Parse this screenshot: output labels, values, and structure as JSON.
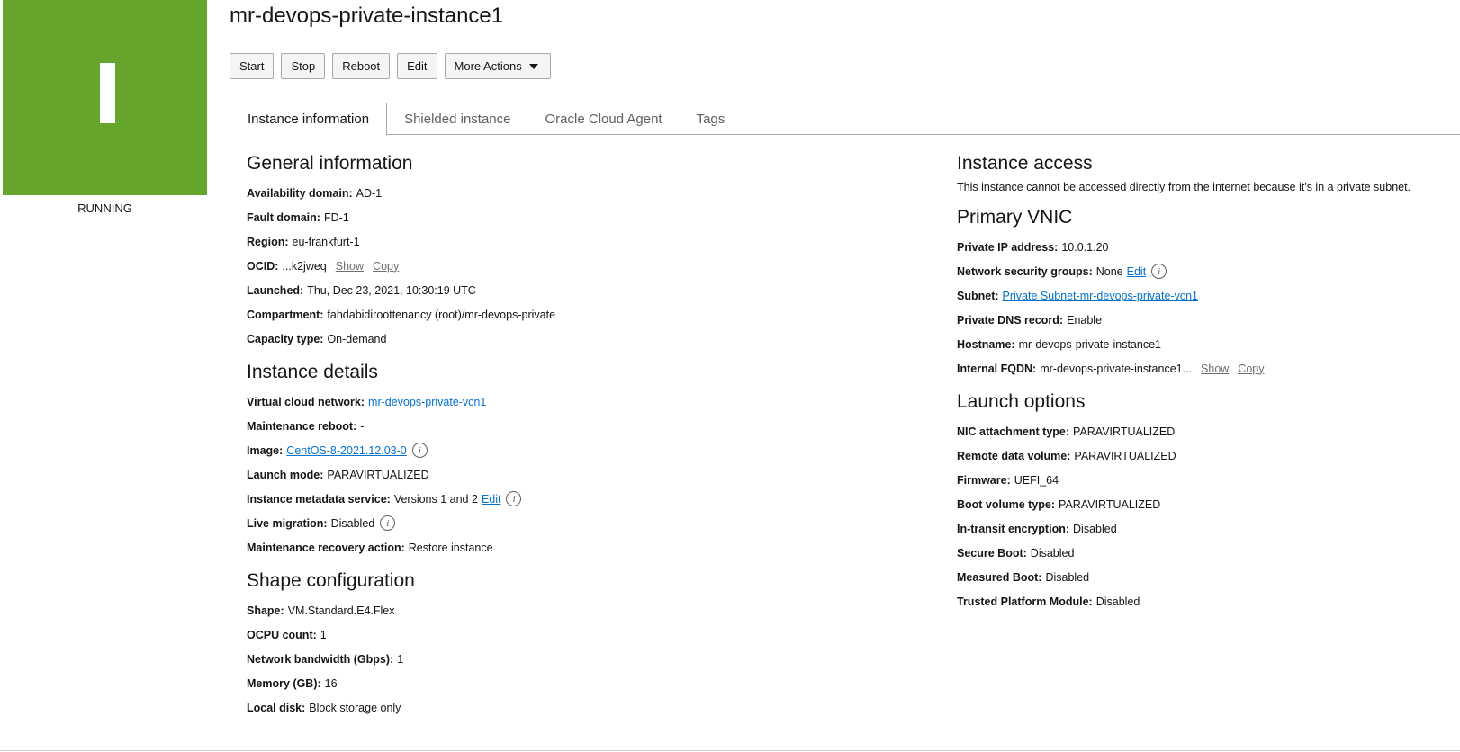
{
  "status": {
    "letter_icon": "instance-letter-icon",
    "state": "RUNNING",
    "color": "#66a52b"
  },
  "title": "mr-devops-private-instance1",
  "actions": {
    "start": "Start",
    "stop": "Stop",
    "reboot": "Reboot",
    "edit": "Edit",
    "more": "More Actions"
  },
  "tabs": [
    "Instance information",
    "Shielded instance",
    "Oracle Cloud Agent",
    "Tags"
  ],
  "general": {
    "title": "General information",
    "availability_domain": {
      "label": "Availability domain:",
      "value": "AD-1"
    },
    "fault_domain": {
      "label": "Fault domain:",
      "value": "FD-1"
    },
    "region": {
      "label": "Region:",
      "value": "eu-frankfurt-1"
    },
    "ocid": {
      "label": "OCID:",
      "value": "...k2jweq",
      "show": "Show",
      "copy": "Copy"
    },
    "launched": {
      "label": "Launched:",
      "value": "Thu, Dec 23, 2021, 10:30:19 UTC"
    },
    "compartment": {
      "label": "Compartment:",
      "value": "fahdabidiroottenancy (root)/mr-devops-private"
    },
    "capacity": {
      "label": "Capacity type:",
      "value": "On-demand"
    }
  },
  "details": {
    "title": "Instance details",
    "vcn": {
      "label": "Virtual cloud network:",
      "value": "mr-devops-private-vcn1"
    },
    "maint_reboot": {
      "label": "Maintenance reboot:",
      "value": "-"
    },
    "image": {
      "label": "Image:",
      "value": "CentOS-8-2021.12.03-0"
    },
    "launch_mode": {
      "label": "Launch mode:",
      "value": "PARAVIRTUALIZED"
    },
    "metadata": {
      "label": "Instance metadata service:",
      "value": "Versions 1 and 2",
      "edit": "Edit"
    },
    "live_migration": {
      "label": "Live migration:",
      "value": "Disabled"
    },
    "recovery": {
      "label": "Maintenance recovery action:",
      "value": "Restore instance"
    }
  },
  "shape": {
    "title": "Shape configuration",
    "shape": {
      "label": "Shape:",
      "value": "VM.Standard.E4.Flex"
    },
    "ocpu": {
      "label": "OCPU count:",
      "value": "1"
    },
    "bandwidth": {
      "label": "Network bandwidth (Gbps):",
      "value": "1"
    },
    "memory": {
      "label": "Memory (GB):",
      "value": "16"
    },
    "disk": {
      "label": "Local disk:",
      "value": "Block storage only"
    }
  },
  "access": {
    "title": "Instance access",
    "text": "This instance cannot be accessed directly from the internet because it's in a private subnet."
  },
  "vnic": {
    "title": "Primary VNIC",
    "private_ip": {
      "label": "Private IP address:",
      "value": "10.0.1.20"
    },
    "nsg": {
      "label": "Network security groups:",
      "value": "None",
      "edit": "Edit"
    },
    "subnet": {
      "label": "Subnet:",
      "value": "Private Subnet-mr-devops-private-vcn1"
    },
    "dns": {
      "label": "Private DNS record:",
      "value": "Enable"
    },
    "hostname": {
      "label": "Hostname:",
      "value": "mr-devops-private-instance1"
    },
    "fqdn": {
      "label": "Internal FQDN:",
      "value": "mr-devops-private-instance1...",
      "show": "Show",
      "copy": "Copy"
    }
  },
  "launch": {
    "title": "Launch options",
    "nic": {
      "label": "NIC attachment type:",
      "value": "PARAVIRTUALIZED"
    },
    "remote": {
      "label": "Remote data volume:",
      "value": "PARAVIRTUALIZED"
    },
    "firmware": {
      "label": "Firmware:",
      "value": "UEFI_64"
    },
    "boot": {
      "label": "Boot volume type:",
      "value": "PARAVIRTUALIZED"
    },
    "transit": {
      "label": "In-transit encryption:",
      "value": "Disabled"
    },
    "secure": {
      "label": "Secure Boot:",
      "value": "Disabled"
    },
    "measured": {
      "label": "Measured Boot:",
      "value": "Disabled"
    },
    "tpm": {
      "label": "Trusted Platform Module:",
      "value": "Disabled"
    }
  },
  "info_glyph": "i"
}
